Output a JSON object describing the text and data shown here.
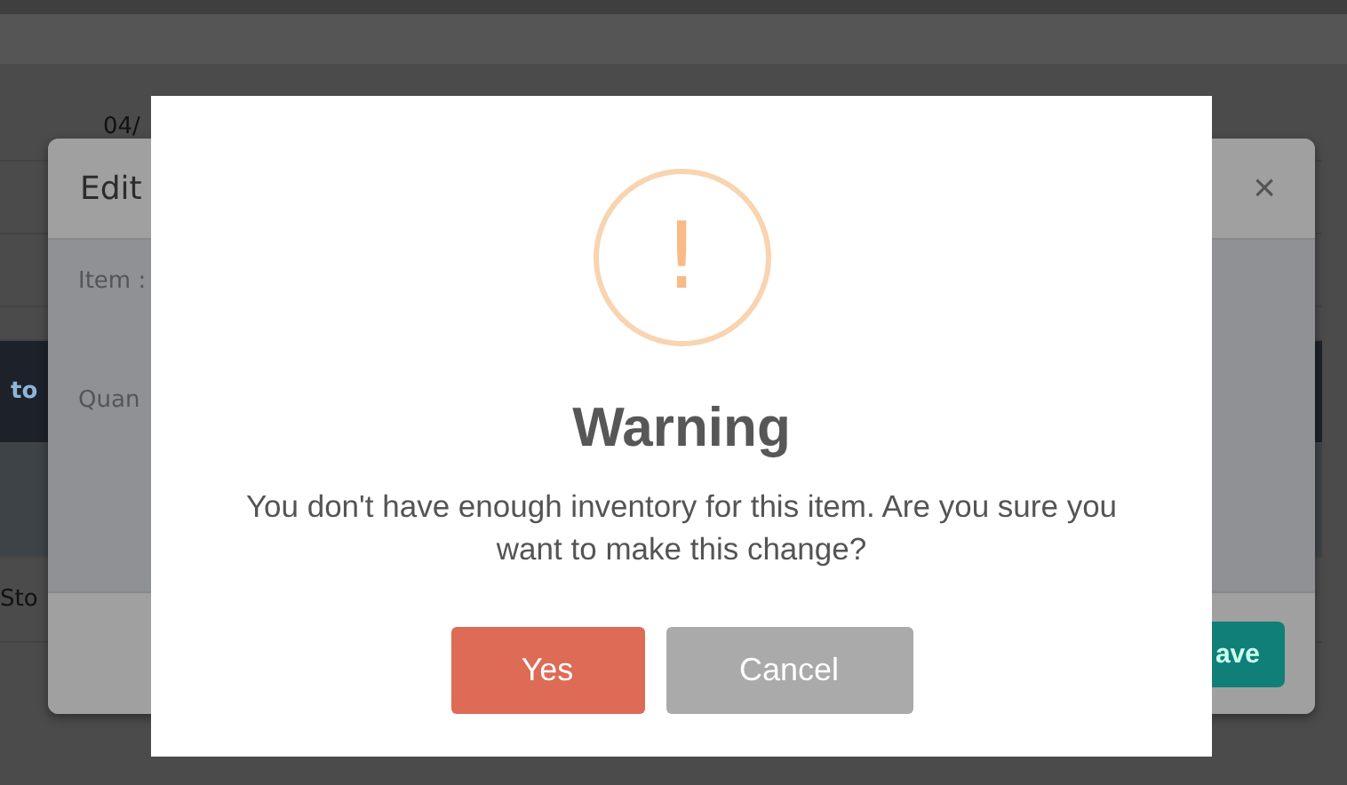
{
  "page": {
    "table_cell": "04/",
    "banner_text": "to",
    "row_text": "Sto"
  },
  "edit_modal": {
    "title": "Edit",
    "close": "×",
    "fields": [
      {
        "label": "Item :"
      },
      {
        "label": "Quan"
      }
    ],
    "save_button": "ave"
  },
  "warning_dialog": {
    "icon": "!",
    "title": "Warning",
    "message": "You don't have enough inventory for this item. Are you sure you want to make this change?",
    "buttons": [
      {
        "label": "Yes",
        "kind": "confirm"
      },
      {
        "label": "Cancel",
        "kind": "cancel"
      }
    ]
  }
}
